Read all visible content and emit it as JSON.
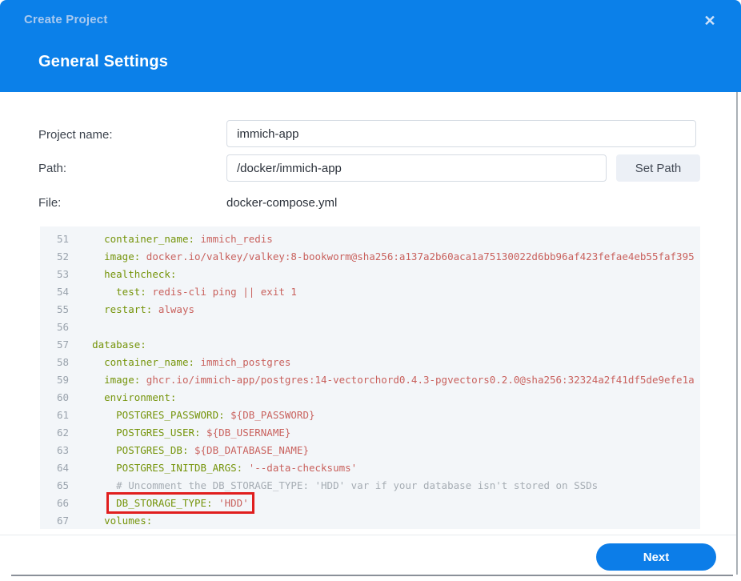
{
  "dialog": {
    "title": "Create Project",
    "close_icon": "✕",
    "heading": "General Settings"
  },
  "form": {
    "project_name_label": "Project name:",
    "project_name_value": "immich-app",
    "path_label": "Path:",
    "path_value": "/docker/immich-app",
    "set_path_button": "Set Path",
    "file_label": "File:",
    "file_value": "docker-compose.yml"
  },
  "editor": {
    "file_type": "yaml",
    "highlighted_line": 66,
    "lines": [
      {
        "num": 51,
        "indent": 4,
        "tokens": [
          {
            "t": "key",
            "v": "container_name:"
          },
          {
            "t": "val",
            "v": " immich_redis"
          }
        ]
      },
      {
        "num": 52,
        "indent": 4,
        "tokens": [
          {
            "t": "key",
            "v": "image:"
          },
          {
            "t": "val",
            "v": " docker.io/valkey/valkey:8-bookworm@sha256:a137a2b60aca1a75130022d6bb96af423fefae4eb55faf395"
          }
        ]
      },
      {
        "num": 53,
        "indent": 4,
        "tokens": [
          {
            "t": "key",
            "v": "healthcheck:"
          }
        ]
      },
      {
        "num": 54,
        "indent": 6,
        "tokens": [
          {
            "t": "key",
            "v": "test:"
          },
          {
            "t": "val",
            "v": " redis-cli ping || exit 1"
          }
        ]
      },
      {
        "num": 55,
        "indent": 4,
        "tokens": [
          {
            "t": "key",
            "v": "restart:"
          },
          {
            "t": "val",
            "v": " always"
          }
        ]
      },
      {
        "num": 56,
        "indent": 0,
        "tokens": []
      },
      {
        "num": 57,
        "indent": 2,
        "tokens": [
          {
            "t": "key",
            "v": "database:"
          }
        ]
      },
      {
        "num": 58,
        "indent": 4,
        "tokens": [
          {
            "t": "key",
            "v": "container_name:"
          },
          {
            "t": "val",
            "v": " immich_postgres"
          }
        ]
      },
      {
        "num": 59,
        "indent": 4,
        "tokens": [
          {
            "t": "key",
            "v": "image:"
          },
          {
            "t": "val",
            "v": " ghcr.io/immich-app/postgres:14-vectorchord0.4.3-pgvectors0.2.0@sha256:32324a2f41df5de9efe1a"
          }
        ]
      },
      {
        "num": 60,
        "indent": 4,
        "tokens": [
          {
            "t": "key",
            "v": "environment:"
          }
        ]
      },
      {
        "num": 61,
        "indent": 6,
        "tokens": [
          {
            "t": "key",
            "v": "POSTGRES_PASSWORD:"
          },
          {
            "t": "val",
            "v": " ${DB_PASSWORD}"
          }
        ]
      },
      {
        "num": 62,
        "indent": 6,
        "tokens": [
          {
            "t": "key",
            "v": "POSTGRES_USER:"
          },
          {
            "t": "val",
            "v": " ${DB_USERNAME}"
          }
        ]
      },
      {
        "num": 63,
        "indent": 6,
        "tokens": [
          {
            "t": "key",
            "v": "POSTGRES_DB:"
          },
          {
            "t": "val",
            "v": " ${DB_DATABASE_NAME}"
          }
        ]
      },
      {
        "num": 64,
        "indent": 6,
        "tokens": [
          {
            "t": "key",
            "v": "POSTGRES_INITDB_ARGS:"
          },
          {
            "t": "val",
            "v": " '--data-checksums'"
          }
        ]
      },
      {
        "num": 65,
        "indent": 6,
        "tokens": [
          {
            "t": "comment",
            "v": "# Uncomment the DB_STORAGE_TYPE: 'HDD' var if your database isn't stored on SSDs"
          }
        ]
      },
      {
        "num": 66,
        "indent": 6,
        "boxed": true,
        "tokens": [
          {
            "t": "key",
            "v": "DB_STORAGE_TYPE:"
          },
          {
            "t": "val",
            "v": " 'HDD'"
          }
        ]
      },
      {
        "num": 67,
        "indent": 4,
        "tokens": [
          {
            "t": "key",
            "v": "volumes:"
          }
        ]
      }
    ]
  },
  "footer": {
    "next_button": "Next"
  },
  "colors": {
    "header_blue": "#0b80e9",
    "next_button_blue": "#0c7de8",
    "highlight_red": "#e01e1e",
    "yaml_key_green": "#75940a",
    "yaml_value_red": "#c9625e",
    "comment_gray": "#a6adb4",
    "editor_background": "#f3f6f9"
  }
}
